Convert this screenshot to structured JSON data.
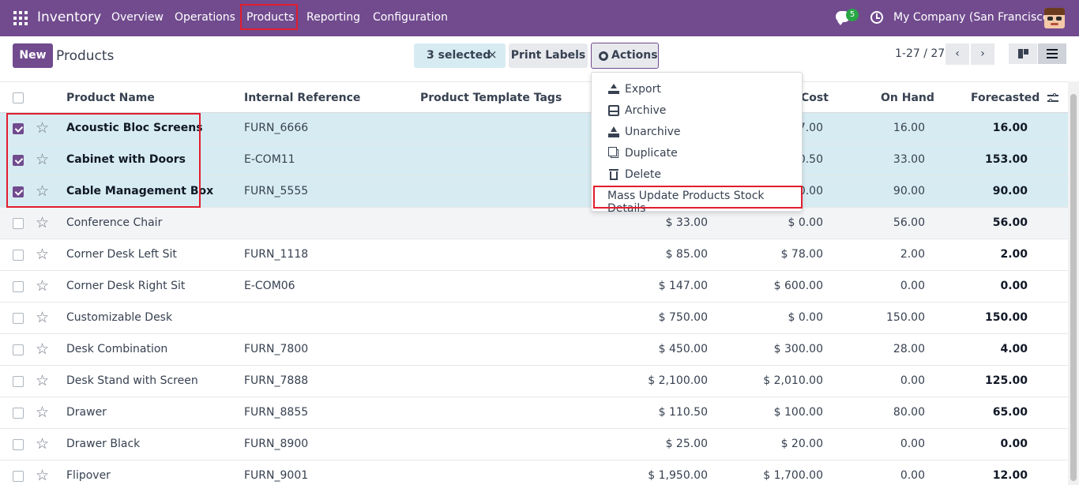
{
  "navbar": {
    "app_name": "Inventory",
    "menu": [
      "Overview",
      "Operations",
      "Products",
      "Reporting",
      "Configuration"
    ],
    "chat_count": "5",
    "company": "My Company (San Francisco)",
    "active_item": "Products"
  },
  "control": {
    "new_label": "New",
    "title": "Products",
    "selected_label": "3 selected",
    "clear_symbol": "×",
    "print_label": "Print Labels",
    "actions_label": "Actions",
    "pager": "1-27 / 27",
    "prev": "‹",
    "next": "›"
  },
  "table": {
    "headers": [
      "Product Name",
      "Internal Reference",
      "Product Template Tags",
      "Cost",
      "On Hand",
      "Forecasted"
    ],
    "rows": [
      {
        "name": "Acoustic Bloc Screens",
        "ref": "FURN_6666",
        "price": "",
        "cost": "7.00",
        "on_hand": "16.00",
        "forecast": "16.00",
        "checked": true
      },
      {
        "name": "Cabinet with Doors",
        "ref": "E-COM11",
        "price": "",
        "cost": "0.50",
        "on_hand": "33.00",
        "forecast": "153.00",
        "checked": true
      },
      {
        "name": "Cable Management Box",
        "ref": "FURN_5555",
        "price": "",
        "cost": "0.00",
        "on_hand": "90.00",
        "forecast": "90.00",
        "checked": true
      },
      {
        "name": "Conference Chair",
        "ref": "",
        "price": "$ 33.00",
        "cost": "$ 0.00",
        "on_hand": "56.00",
        "forecast": "56.00",
        "checked": false
      },
      {
        "name": "Corner Desk Left Sit",
        "ref": "FURN_1118",
        "price": "$ 85.00",
        "cost": "$ 78.00",
        "on_hand": "2.00",
        "forecast": "2.00",
        "checked": false
      },
      {
        "name": "Corner Desk Right Sit",
        "ref": "E-COM06",
        "price": "$ 147.00",
        "cost": "$ 600.00",
        "on_hand": "0.00",
        "forecast": "0.00",
        "checked": false
      },
      {
        "name": "Customizable Desk",
        "ref": "",
        "price": "$ 750.00",
        "cost": "$ 0.00",
        "on_hand": "150.00",
        "forecast": "150.00",
        "checked": false
      },
      {
        "name": "Desk Combination",
        "ref": "FURN_7800",
        "price": "$ 450.00",
        "cost": "$ 300.00",
        "on_hand": "28.00",
        "forecast": "4.00",
        "checked": false
      },
      {
        "name": "Desk Stand with Screen",
        "ref": "FURN_7888",
        "price": "$ 2,100.00",
        "cost": "$ 2,010.00",
        "on_hand": "0.00",
        "forecast": "125.00",
        "checked": false
      },
      {
        "name": "Drawer",
        "ref": "FURN_8855",
        "price": "$ 110.50",
        "cost": "$ 100.00",
        "on_hand": "80.00",
        "forecast": "65.00",
        "checked": false
      },
      {
        "name": "Drawer Black",
        "ref": "FURN_8900",
        "price": "$ 25.00",
        "cost": "$ 20.00",
        "on_hand": "0.00",
        "forecast": "0.00",
        "checked": false
      },
      {
        "name": "Flipover",
        "ref": "FURN_9001",
        "price": "$ 1,950.00",
        "cost": "$ 1,700.00",
        "on_hand": "0.00",
        "forecast": "12.00",
        "checked": false
      }
    ]
  },
  "actions_menu": {
    "items": [
      {
        "label": "Export",
        "icon": "export-icon"
      },
      {
        "label": "Archive",
        "icon": "archive-icon"
      },
      {
        "label": "Unarchive",
        "icon": "unarchive-icon"
      },
      {
        "label": "Duplicate",
        "icon": "duplicate-icon"
      },
      {
        "label": "Delete",
        "icon": "delete-icon"
      },
      {
        "label": "Mass Update Products Stock Details",
        "icon": ""
      }
    ]
  },
  "colors": {
    "brand": "#714b8e",
    "selected_row": "#d7ecf2",
    "highlight": "#e11d2e"
  }
}
